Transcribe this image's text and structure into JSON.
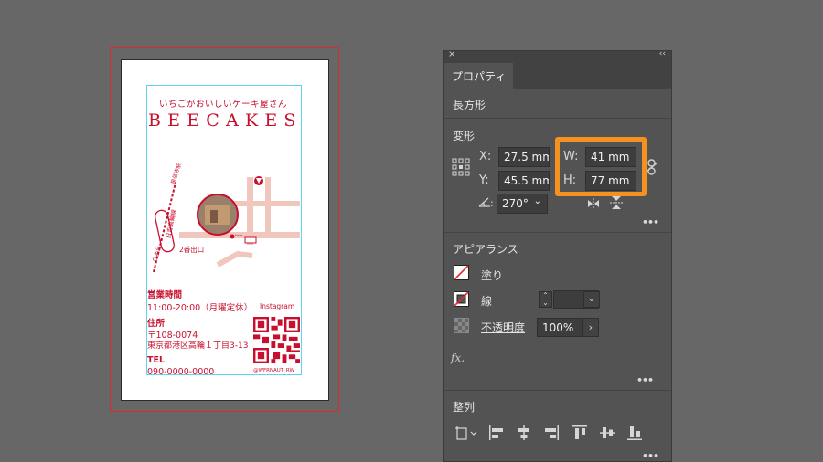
{
  "card": {
    "tagline": "いちごがおいしいケーキ屋さん",
    "brand": "BEECAKES",
    "hours_label": "営業時間",
    "hours": "11:00-20:00（月曜定休）",
    "address_label": "住所",
    "postal": "〒108-0074",
    "address": "東京都港区高輪１丁目3-13",
    "tel_label": "TEL",
    "tel": "090-0000-0000",
    "instagram_label": "Instagram",
    "instagram_handle": "@WFRNAUT_RW",
    "map": {
      "station_1": "泉岳寺駅",
      "station_2": "日吉高輪線",
      "station_3": "白金台",
      "exit": "2番出口",
      "here": "Here"
    }
  },
  "panel": {
    "close": "×",
    "collapse": "‹‹",
    "tab": "プロパティ",
    "object_type": "長方形",
    "transform": {
      "title": "変形",
      "x_label": "X:",
      "x_value": "27.5 mm",
      "y_label": "Y:",
      "y_value": "45.5 mm",
      "w_label": "W:",
      "w_value": "41 mm",
      "h_label": "H:",
      "h_value": "77 mm",
      "angle_label": ":",
      "angle_value": "270°"
    },
    "appearance": {
      "title": "アピアランス",
      "fill_label": "塗り",
      "stroke_label": "線",
      "opacity_label": "不透明度",
      "opacity_value": "100%",
      "fx_label": "fx."
    },
    "align": {
      "title": "整列"
    },
    "more": "•••"
  },
  "colors": {
    "accent": "#f59120",
    "brand_red": "#c8102e",
    "map_pink": "#f0c6bd",
    "panel_bg": "#535353",
    "canvas_bg": "#676767"
  }
}
